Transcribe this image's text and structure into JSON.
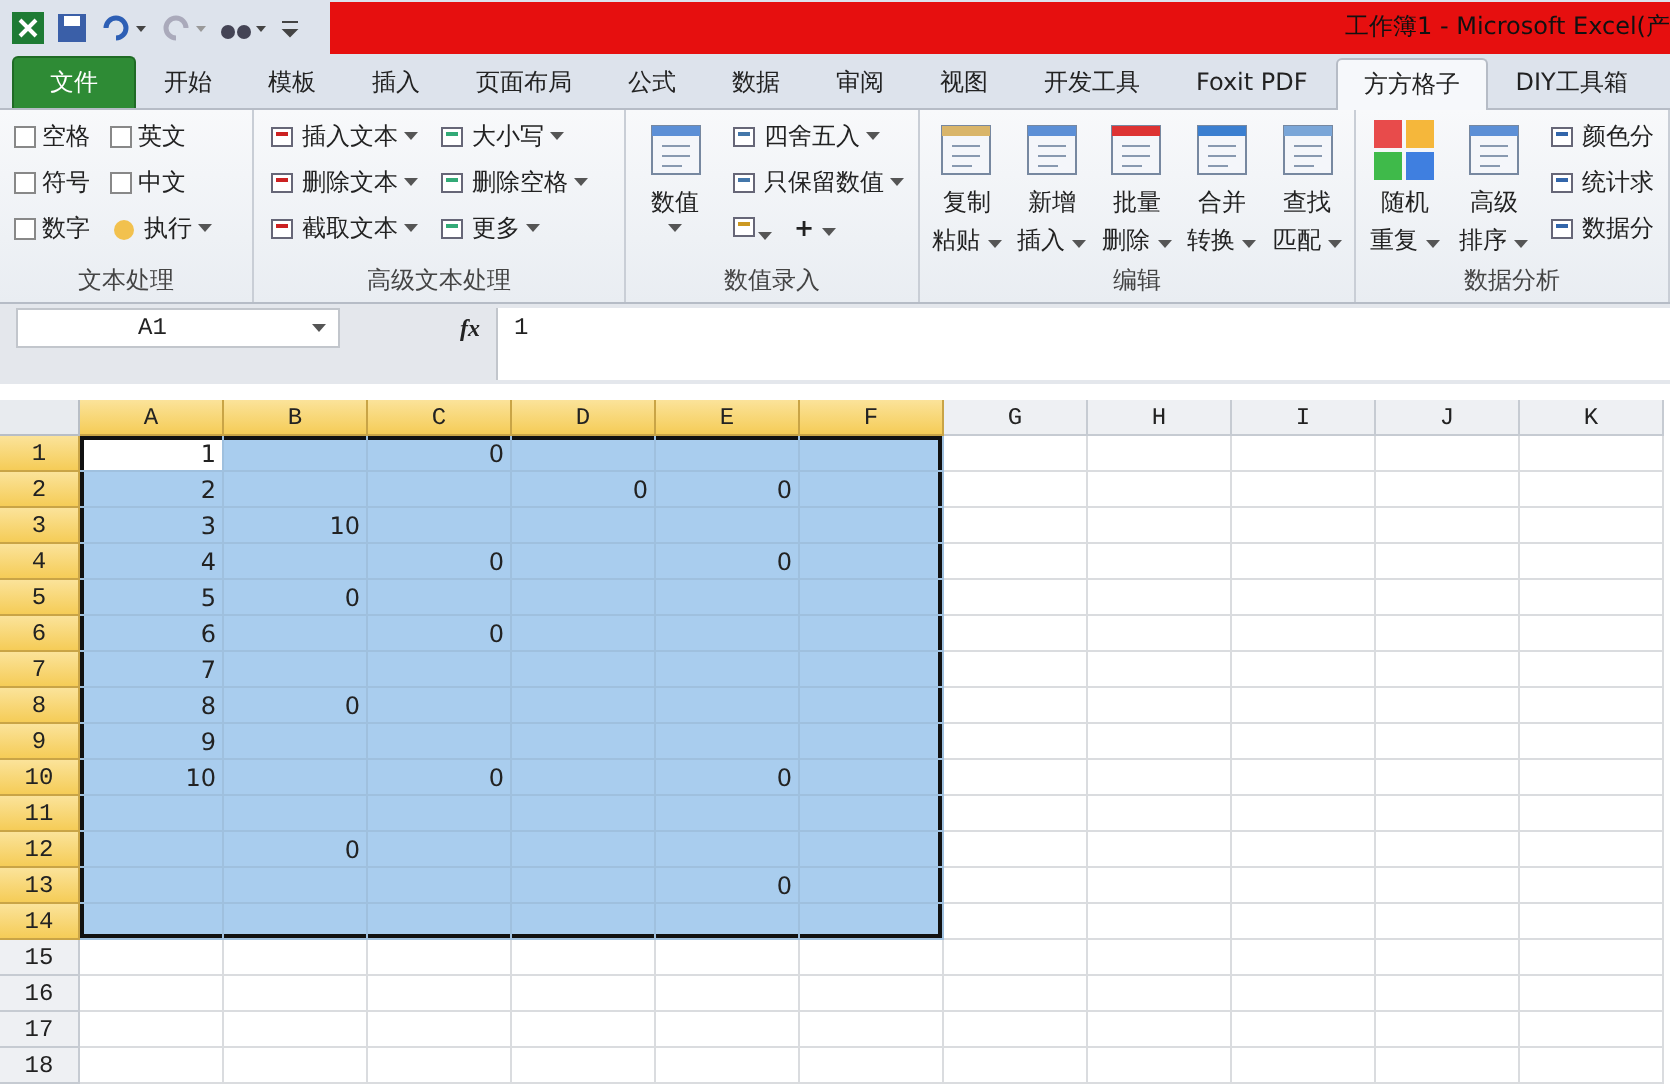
{
  "title_bar": {
    "title": "工作簿1  -  Microsoft Excel(产"
  },
  "tabs": [
    {
      "label": "文件",
      "kind": "file",
      "selected": false
    },
    {
      "label": "开始",
      "kind": "tab",
      "selected": false
    },
    {
      "label": "模板",
      "kind": "tab",
      "selected": false
    },
    {
      "label": "插入",
      "kind": "tab",
      "selected": false
    },
    {
      "label": "页面布局",
      "kind": "tab",
      "selected": false
    },
    {
      "label": "公式",
      "kind": "tab",
      "selected": false
    },
    {
      "label": "数据",
      "kind": "tab",
      "selected": false
    },
    {
      "label": "审阅",
      "kind": "tab",
      "selected": false
    },
    {
      "label": "视图",
      "kind": "tab",
      "selected": false
    },
    {
      "label": "开发工具",
      "kind": "tab",
      "selected": false
    },
    {
      "label": "Foxit PDF",
      "kind": "tab",
      "selected": false
    },
    {
      "label": "方方格子",
      "kind": "tab",
      "selected": true
    },
    {
      "label": "DIY工具箱",
      "kind": "tab",
      "selected": false
    }
  ],
  "ribbon": {
    "groups": [
      {
        "label": "文本处理",
        "kind": "checks",
        "items": [
          {
            "label": "空格",
            "checked": false
          },
          {
            "label": "英文",
            "checked": false
          },
          {
            "label": "符号",
            "checked": false
          },
          {
            "label": "中文",
            "checked": false
          },
          {
            "label": "数字",
            "checked": false
          }
        ],
        "button": "执行"
      },
      {
        "label": "高级文本处理",
        "kind": "small",
        "items": [
          "插入文本",
          "大小写",
          "删除文本",
          "删除空格",
          "截取文本",
          "更多"
        ]
      },
      {
        "label": "数值录入",
        "kind": "mixed",
        "large": "数值",
        "items": [
          "四舍五入",
          "只保留数值"
        ],
        "plus": "+"
      },
      {
        "label": "编辑",
        "kind": "large",
        "items": [
          {
            "top": "复制",
            "bottom": "粘贴"
          },
          {
            "top": "新增",
            "bottom": "插入"
          },
          {
            "top": "批量",
            "bottom": "删除"
          },
          {
            "top": "合并",
            "bottom": "转换"
          },
          {
            "top": "查找",
            "bottom": "匹配"
          }
        ]
      },
      {
        "label": "数据分析",
        "kind": "large",
        "items": [
          {
            "top": "随机",
            "bottom": "重复"
          },
          {
            "top": "高级",
            "bottom": "排序"
          }
        ],
        "small": [
          "颜色分",
          "统计求",
          "数据分"
        ]
      }
    ]
  },
  "formula_bar": {
    "name_box": "A1",
    "fx": "fx",
    "value": "1"
  },
  "sheet": {
    "columns": [
      {
        "label": "A",
        "selected": true
      },
      {
        "label": "B",
        "selected": true
      },
      {
        "label": "C",
        "selected": true
      },
      {
        "label": "D",
        "selected": true
      },
      {
        "label": "E",
        "selected": true
      },
      {
        "label": "F",
        "selected": true
      },
      {
        "label": "G",
        "selected": false
      },
      {
        "label": "H",
        "selected": false
      },
      {
        "label": "I",
        "selected": false
      },
      {
        "label": "J",
        "selected": false
      },
      {
        "label": "K",
        "selected": false
      }
    ],
    "rows": [
      {
        "label": "1",
        "selected": true,
        "active": true,
        "cells": [
          "1",
          null,
          "0",
          null,
          null,
          null
        ]
      },
      {
        "label": "2",
        "selected": true,
        "active": false,
        "cells": [
          "2",
          null,
          null,
          "0",
          "0",
          null
        ]
      },
      {
        "label": "3",
        "selected": true,
        "active": false,
        "cells": [
          "3",
          "10",
          null,
          null,
          null,
          null
        ]
      },
      {
        "label": "4",
        "selected": true,
        "active": false,
        "cells": [
          "4",
          null,
          "0",
          null,
          "0",
          null
        ]
      },
      {
        "label": "5",
        "selected": true,
        "active": false,
        "cells": [
          "5",
          "0",
          null,
          null,
          null,
          null
        ]
      },
      {
        "label": "6",
        "selected": true,
        "active": false,
        "cells": [
          "6",
          null,
          "0",
          null,
          null,
          null
        ]
      },
      {
        "label": "7",
        "selected": true,
        "active": false,
        "cells": [
          "7",
          null,
          null,
          null,
          null,
          null
        ]
      },
      {
        "label": "8",
        "selected": true,
        "active": false,
        "cells": [
          "8",
          "0",
          null,
          null,
          null,
          null
        ]
      },
      {
        "label": "9",
        "selected": true,
        "active": false,
        "cells": [
          "9",
          null,
          null,
          null,
          null,
          null
        ]
      },
      {
        "label": "10",
        "selected": true,
        "active": false,
        "cells": [
          "10",
          null,
          "0",
          null,
          "0",
          null
        ]
      },
      {
        "label": "11",
        "selected": true,
        "active": false,
        "cells": [
          null,
          null,
          null,
          null,
          null,
          null
        ]
      },
      {
        "label": "12",
        "selected": true,
        "active": false,
        "cells": [
          null,
          "0",
          null,
          null,
          null,
          null
        ]
      },
      {
        "label": "13",
        "selected": true,
        "active": false,
        "cells": [
          null,
          null,
          null,
          null,
          "0",
          null
        ]
      },
      {
        "label": "14",
        "selected": true,
        "active": false,
        "cells": [
          null,
          null,
          null,
          null,
          null,
          null
        ]
      },
      {
        "label": "15",
        "selected": false,
        "active": false,
        "cells": []
      },
      {
        "label": "16",
        "selected": false,
        "active": false,
        "cells": []
      },
      {
        "label": "17",
        "selected": false,
        "active": false,
        "cells": []
      },
      {
        "label": "18",
        "selected": false,
        "active": false,
        "cells": []
      }
    ]
  }
}
